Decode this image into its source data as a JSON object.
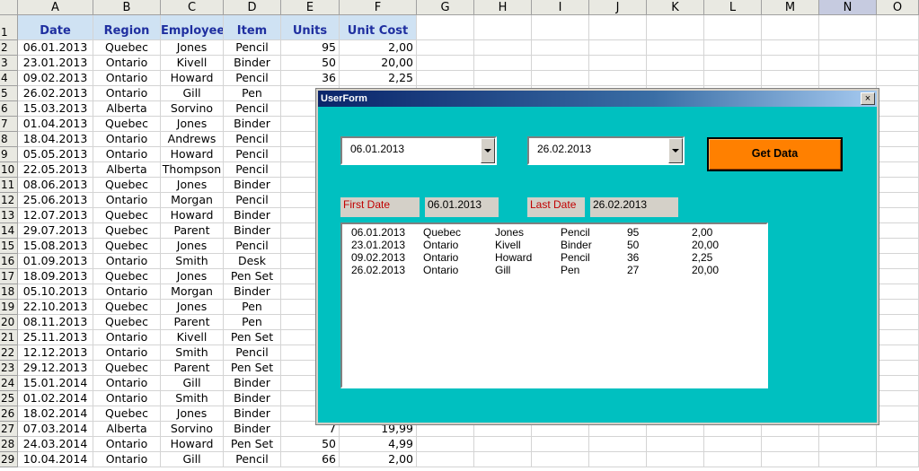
{
  "columns": [
    "A",
    "B",
    "C",
    "D",
    "E",
    "F",
    "G",
    "H",
    "I",
    "J",
    "K",
    "L",
    "M",
    "N",
    "O"
  ],
  "selected_column": "N",
  "table_headers": [
    "Date",
    "Region",
    "Employee",
    "Item",
    "Units",
    "Unit Cost"
  ],
  "rows": [
    [
      "06.01.2013",
      "Quebec",
      "Jones",
      "Pencil",
      "95",
      "2,00"
    ],
    [
      "23.01.2013",
      "Ontario",
      "Kivell",
      "Binder",
      "50",
      "20,00"
    ],
    [
      "09.02.2013",
      "Ontario",
      "Howard",
      "Pencil",
      "36",
      "2,25"
    ],
    [
      "26.02.2013",
      "Ontario",
      "Gill",
      "Pen",
      "",
      ""
    ],
    [
      "15.03.2013",
      "Alberta",
      "Sorvino",
      "Pencil",
      "",
      ""
    ],
    [
      "01.04.2013",
      "Quebec",
      "Jones",
      "Binder",
      "",
      ""
    ],
    [
      "18.04.2013",
      "Ontario",
      "Andrews",
      "Pencil",
      "",
      ""
    ],
    [
      "05.05.2013",
      "Ontario",
      "Howard",
      "Pencil",
      "",
      ""
    ],
    [
      "22.05.2013",
      "Alberta",
      "Thompson",
      "Pencil",
      "",
      ""
    ],
    [
      "08.06.2013",
      "Quebec",
      "Jones",
      "Binder",
      "",
      ""
    ],
    [
      "25.06.2013",
      "Ontario",
      "Morgan",
      "Pencil",
      "",
      ""
    ],
    [
      "12.07.2013",
      "Quebec",
      "Howard",
      "Binder",
      "",
      ""
    ],
    [
      "29.07.2013",
      "Quebec",
      "Parent",
      "Binder",
      "",
      ""
    ],
    [
      "15.08.2013",
      "Quebec",
      "Jones",
      "Pencil",
      "",
      ""
    ],
    [
      "01.09.2013",
      "Ontario",
      "Smith",
      "Desk",
      "",
      ""
    ],
    [
      "18.09.2013",
      "Quebec",
      "Jones",
      "Pen Set",
      "",
      ""
    ],
    [
      "05.10.2013",
      "Ontario",
      "Morgan",
      "Binder",
      "",
      ""
    ],
    [
      "22.10.2013",
      "Quebec",
      "Jones",
      "Pen",
      "",
      ""
    ],
    [
      "08.11.2013",
      "Quebec",
      "Parent",
      "Pen",
      "",
      ""
    ],
    [
      "25.11.2013",
      "Ontario",
      "Kivell",
      "Pen Set",
      "",
      ""
    ],
    [
      "12.12.2013",
      "Ontario",
      "Smith",
      "Pencil",
      "",
      ""
    ],
    [
      "29.12.2013",
      "Quebec",
      "Parent",
      "Pen Set",
      "",
      ""
    ],
    [
      "15.01.2014",
      "Ontario",
      "Gill",
      "Binder",
      "",
      ""
    ],
    [
      "01.02.2014",
      "Ontario",
      "Smith",
      "Binder",
      "",
      ""
    ],
    [
      "18.02.2014",
      "Quebec",
      "Jones",
      "Binder",
      "",
      ""
    ],
    [
      "07.03.2014",
      "Alberta",
      "Sorvino",
      "Binder",
      "7",
      "19,99"
    ],
    [
      "24.03.2014",
      "Ontario",
      "Howard",
      "Pen Set",
      "50",
      "4,99"
    ],
    [
      "10.04.2014",
      "Ontario",
      "Gill",
      "Pencil",
      "66",
      "2,00"
    ]
  ],
  "form": {
    "title": "UserForm",
    "close_label": "×",
    "start_date": "06.01.2013",
    "end_date": "26.02.2013",
    "get_data_label": "Get Data",
    "first_date_label": "First Date",
    "first_date_value": "06.01.2013",
    "last_date_label": "Last Date",
    "last_date_value": "26.02.2013",
    "results": [
      [
        "06.01.2013",
        "Quebec",
        "Jones",
        "Pencil",
        "95",
        "2,00"
      ],
      [
        "23.01.2013",
        "Ontario",
        "Kivell",
        "Binder",
        "50",
        "20,00"
      ],
      [
        "09.02.2013",
        "Ontario",
        "Howard",
        "Pencil",
        "36",
        "2,25"
      ],
      [
        "26.02.2013",
        "Ontario",
        "Gill",
        "Pen",
        "27",
        "20,00"
      ]
    ]
  }
}
